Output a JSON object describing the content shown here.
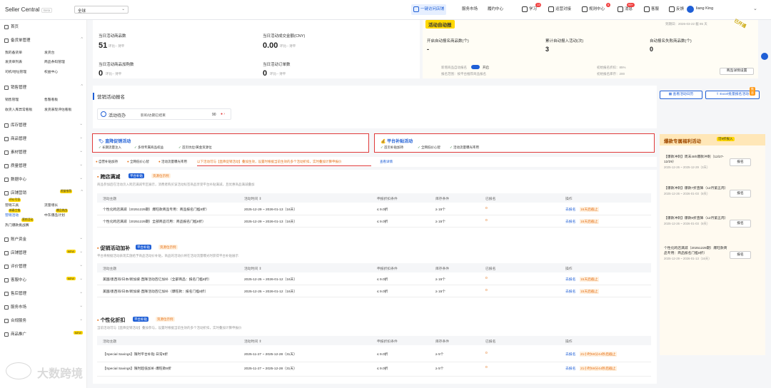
{
  "topbar": {
    "logo": "Seller Central",
    "beta": "Beta",
    "region": "全球",
    "nav_active": "一键访问店铺",
    "nav_items": [
      "服务市场",
      "履约中心"
    ],
    "actions": [
      {
        "icon": "book-icon",
        "label": "学习",
        "badge": "13"
      },
      {
        "icon": "shield-icon",
        "label": "运营对接",
        "badge": ""
      },
      {
        "icon": "report-icon",
        "label": "规则中心",
        "badge": "6"
      },
      {
        "icon": "bell-icon",
        "label": "消息",
        "badge": "99+"
      },
      {
        "icon": "headset-icon",
        "label": "客服",
        "badge": ""
      },
      {
        "icon": "feedback-icon",
        "label": "反馈",
        "badge": ""
      }
    ],
    "user": "liang King"
  },
  "sidebar": {
    "home": "首页",
    "order_mgmt": "备货单管理",
    "order_subs": [
      "我的备货单",
      "发货台",
      "发货单列表",
      "商品条码管理",
      "司机/地址管理",
      "权益中心"
    ],
    "sales_mgmt": "销售管理",
    "sales_subs": [
      "销售管理",
      "售罄看板",
      "收货入库异常看板",
      "发货表现评估看板"
    ],
    "items": [
      "库存管理",
      "商品管理",
      "素材管理",
      "质量管理",
      "数据中心"
    ],
    "marketing": "店铺营销",
    "marketing_tag": "限量推荐",
    "marketing_subs": [
      "营销工具",
      "流量增长",
      "营销活动",
      "中东爆品计划",
      "热门爆款挑战赛"
    ],
    "marketing_hot": [
      "评价引导",
      "营销活动",
      "新春主推",
      "爆品挑战"
    ],
    "bottom_items": [
      {
        "label": "账户资金",
        "tag": ""
      },
      {
        "label": "店铺管理",
        "tag": "NEW"
      },
      {
        "label": "评价管理",
        "tag": ""
      },
      {
        "label": "客服中心",
        "tag": "NEW"
      },
      {
        "label": "售后管理",
        "tag": ""
      },
      {
        "label": "服务市场",
        "tag": ""
      },
      {
        "label": "合规服务",
        "tag": ""
      },
      {
        "label": "商品推广",
        "tag": "NEW"
      }
    ]
  },
  "stats": [
    {
      "label": "当日活动商品数",
      "value": "51",
      "sub": "环比-- 持平"
    },
    {
      "label": "当日活动成交金额(CNY)",
      "value": "0.00",
      "sub": "环比-- 持平"
    },
    {
      "label": "当日活动商品加购数",
      "value": "0",
      "sub": "环比-- 持平"
    },
    {
      "label": "当日活动订单数",
      "value": "0",
      "sub": "环比-- 持平"
    }
  ],
  "auto": {
    "title": "活动自动报",
    "date": "到期日：2026-03-22 截 85 天",
    "corner": "已开通",
    "cols": [
      {
        "label": "开启自动报名商品数(个)",
        "value": "-"
      },
      {
        "label": "累计自动报入活动(次)",
        "value": "3"
      },
      {
        "label": "自动报名失败商品数(个)",
        "value": "0"
      }
    ],
    "switch_label": "新增商品自动报名",
    "switch_state": "开启",
    "scope": "报名范围：按平台推荐商品报名",
    "right1": "初始报名折扣：85%",
    "right2": "初始报名库存：200",
    "btn": "商品详情设置"
  },
  "activity": {
    "title": "营销活动报名",
    "btn1": "查看活动日历",
    "btn2": "Excel批量报名活动",
    "btn2_tag": "推荐",
    "pending_label": "活动待办",
    "pending_text": "影响/达期已结束",
    "pending_count": "90"
  },
  "box1": {
    "title": "直降促销活动",
    "checks": [
      "长期流量注入",
      "多场专属商品权益",
      "首页坑位/黄金资源位"
    ]
  },
  "box2": {
    "title": "平台补贴活动",
    "checks": [
      "首页补贴加持",
      "全网低价心智",
      "活动流量曝光率用"
    ]
  },
  "filters": {
    "items": [
      "自营补贴加持",
      "全网低价心智",
      "活动流量曝光率用"
    ],
    "note": "以下活动可与【直降促销活动】叠加生效，设置时根据当前生效的多个活动折扣，实时叠加计算申报价",
    "link": "查看详情"
  },
  "sections": [
    {
      "title": "跨店满减",
      "tag": "平台补贴",
      "tag2": "资源位示例",
      "desc": "商品参加后在活动页入跨店满减专区展示，消费者购买该活动标签商品享受平台补贴满减，且优惠商品满减叠加",
      "headers": [
        "活动主题",
        "活动时间 ⇕",
        "申报折扣条件",
        "库存条件",
        "已报名",
        "操作"
      ],
      "rows": [
        [
          "个性化跨店满减（20251229期）爆旺款商品专用：商品报名门槛8折）",
          "2025-12-29 ~ 2026-01-13（16天）",
          "≤ 9.0折",
          "≥ 15个",
          "0",
          "去报名",
          "16天后截止"
        ],
        [
          "个性化跨店满减（20251229期）全部商品可用：商品报名门槛8折）",
          "2025-12-29 ~ 2026-01-13（16天）",
          "≤ 9.0折",
          "≥ 15个",
          "0",
          "去报名",
          "16天后截止"
        ]
      ]
    },
    {
      "title": "促销活动加补",
      "tag": "平台补贴",
      "tag2": "资源位示例",
      "desc": "平台将根据活动表现实施给予商品活动价补贴，商品的活动价将在活动流量曝光时获得平台补贴展示",
      "headers": [
        "活动主题",
        "活动时间 ⇕",
        "申报折扣条件",
        "库存条件",
        "已报名",
        "操作"
      ],
      "rows": [
        [
          "美国/墨西哥/日本/新加坡·直降活动百亿加补（全部商品：报名门槛8折）",
          "2025-12-25 ~ 2026-01-12（16天）",
          "≤ 9.0折",
          "≥ 15个",
          "0",
          "去报名",
          "15天后截止"
        ],
        [
          "美国/墨西哥/日本/新加坡·直降活动百亿加补（爆旺款：报名门槛8折）",
          "2025-12-25 ~ 2026-01-12（16天）",
          "≤ 9.0折",
          "≥ 15个",
          "0",
          "去报名",
          "15天后截止"
        ]
      ]
    },
    {
      "title": "个性化折扣",
      "tag": "平台补贴",
      "tag2": "资源位示例",
      "desc": "当前活动可与【直降促销活动】叠加参与，设置时根据当前生效的多个活动折扣，实时叠加计算申报价",
      "headers": [
        "活动主题",
        "活动时间 ⇕",
        "申报折扣条件",
        "库存条件",
        "已报名",
        "操作"
      ],
      "rows": [
        [
          "【Special Savings】限时平台补贴·日常8折",
          "2025-11-27 ~ 2025-12-28（31天）",
          "≤ 9.0折",
          "≥ 5个",
          "0",
          "去报名",
          "21小时59分44秒后截止"
        ],
        [
          "【Special Savings】限时超低加补·爆旺款8折",
          "2025-11-27 ~ 2025-12-28（31天）",
          "≤ 9.0折",
          "≥ 5个",
          "0",
          "去报名",
          "21小时59分44秒后截止"
        ]
      ]
    }
  ],
  "right_panel": {
    "title": "爆款专属福利活动",
    "tag": "可9折报入",
    "items": [
      {
        "title": "【爆款冲刺】周末48h爆款冲刺（12/27-12/29）",
        "date": "2025-12-26 ~ 2025-12-29（3天）",
        "btn": "报名"
      },
      {
        "title": "【爆款冲刺】爆款7折直降（12月第五周）",
        "date": "2025-12-26 ~ 2026-01-03（8天）",
        "btn": "报名"
      },
      {
        "title": "【爆款冲刺】爆款8折直降（12月第五周）",
        "date": "2025-12-26 ~ 2026-01-03（8天）",
        "btn": "报名"
      },
      {
        "title": "个性化跨店满减（20251229期）爆旺款商品专用：商品报名门槛8折）",
        "date": "2025-12-29 ~ 2026-01-13（16天）",
        "btn": "报名"
      }
    ]
  },
  "watermark": "大数跨境",
  "colors": {
    "primary": "#1f5fd6",
    "warning": "#e6731a",
    "redbox": "#e03a3a",
    "yellow": "#ffd800"
  }
}
